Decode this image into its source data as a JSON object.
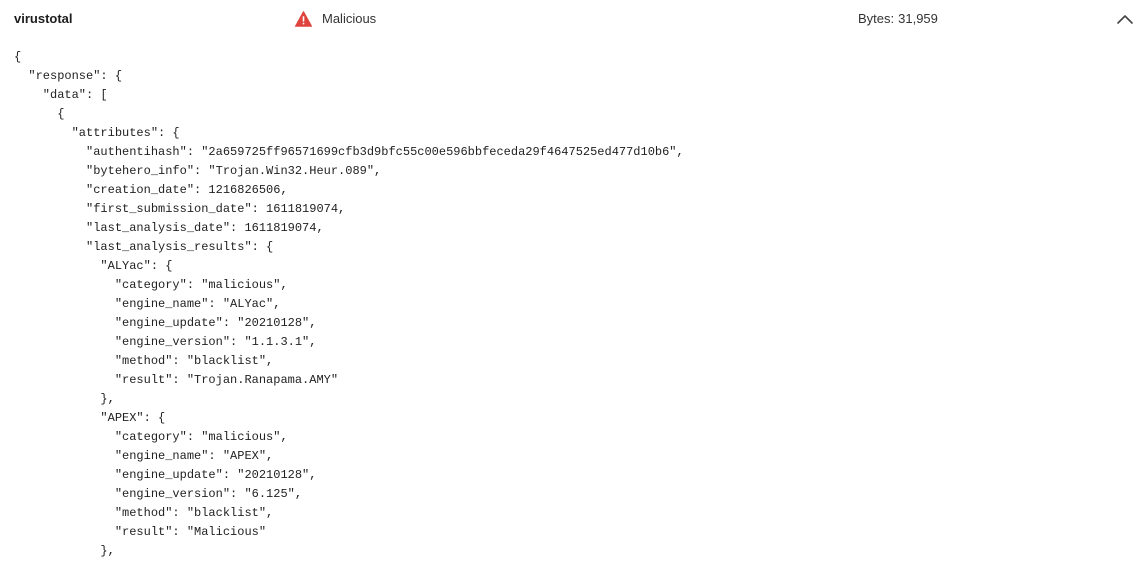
{
  "header": {
    "source_name": "virustotal",
    "verdict": {
      "label": "Malicious",
      "icon": "warning-triangle-icon",
      "color": "#e0443e"
    },
    "bytes_label": "Bytes:",
    "bytes_value": "31,959",
    "collapse_icon": "chevron-up-icon"
  },
  "json_lines": [
    "{",
    "  \"response\": {",
    "    \"data\": [",
    "      {",
    "        \"attributes\": {",
    "          \"authentihash\": \"2a659725ff96571699cfb3d9bfc55c00e596bbfeceda29f4647525ed477d10b6\",",
    "          \"bytehero_info\": \"Trojan.Win32.Heur.089\",",
    "          \"creation_date\": 1216826506,",
    "          \"first_submission_date\": 1611819074,",
    "          \"last_analysis_date\": 1611819074,",
    "          \"last_analysis_results\": {",
    "            \"ALYac\": {",
    "              \"category\": \"malicious\",",
    "              \"engine_name\": \"ALYac\",",
    "              \"engine_update\": \"20210128\",",
    "              \"engine_version\": \"1.1.3.1\",",
    "              \"method\": \"blacklist\",",
    "              \"result\": \"Trojan.Ranapama.AMY\"",
    "            },",
    "            \"APEX\": {",
    "              \"category\": \"malicious\",",
    "              \"engine_name\": \"APEX\",",
    "              \"engine_update\": \"20210128\",",
    "              \"engine_version\": \"6.125\",",
    "              \"method\": \"blacklist\",",
    "              \"result\": \"Malicious\"",
    "            },"
  ]
}
